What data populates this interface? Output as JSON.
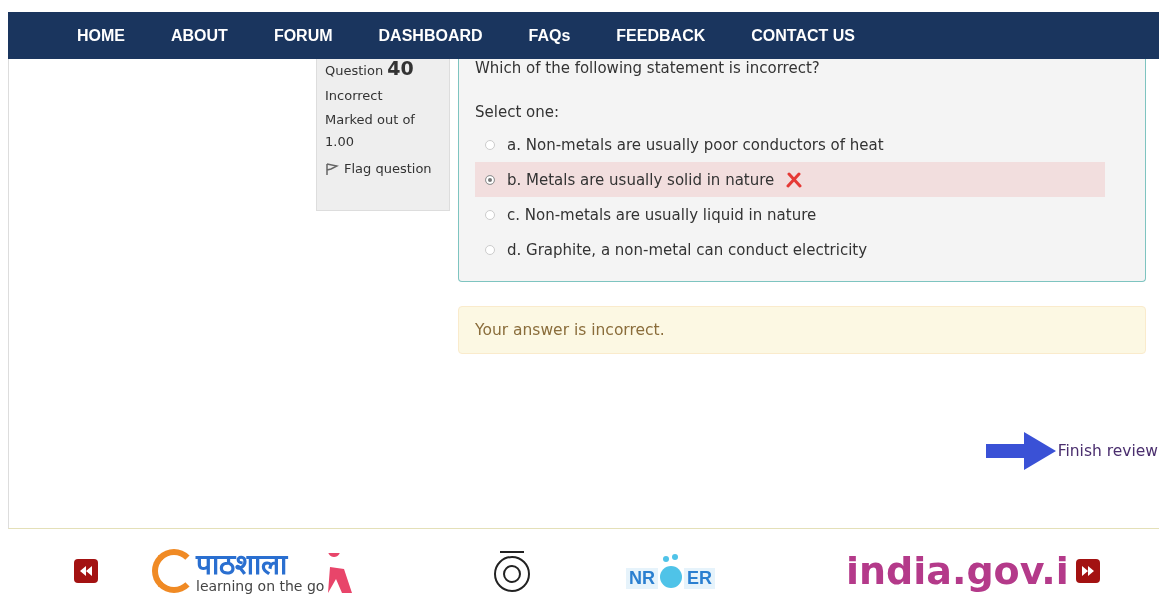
{
  "nav": [
    {
      "label": "HOME",
      "selected": false
    },
    {
      "label": "ABOUT",
      "selected": false
    },
    {
      "label": "FORUM",
      "selected": false
    },
    {
      "label": "DASHBOARD",
      "selected": false
    },
    {
      "label": "FAQs",
      "selected": false
    },
    {
      "label": "FEEDBACK",
      "selected": false
    },
    {
      "label": "CONTACT US",
      "selected": false
    }
  ],
  "info": {
    "question_label": "Question",
    "question_number": "40",
    "status": "Incorrect",
    "marked_label": "Marked out of",
    "marked_value": "1.00",
    "flag": "Flag question"
  },
  "question": {
    "text": "Which of the following statement is incorrect?",
    "prompt": "Select one:",
    "options": [
      {
        "text": "a. Non-metals are usually poor conductors of heat",
        "selected": false,
        "wrong": false
      },
      {
        "text": "b. Metals are usually solid in nature",
        "selected": true,
        "wrong": true
      },
      {
        "text": "c. Non-metals are usually liquid in nature",
        "selected": false,
        "wrong": false
      },
      {
        "text": "d. Graphite, a non-metal can conduct electricity",
        "selected": false,
        "wrong": false
      }
    ]
  },
  "feedback": "Your answer is incorrect.",
  "finish": "Finish review",
  "footer": {
    "epathshala": "पाठशाला",
    "epathshala_tag": "learning on the go",
    "nroer_left": "NR",
    "nroer_right": "ER",
    "india": "india.gov.i"
  }
}
